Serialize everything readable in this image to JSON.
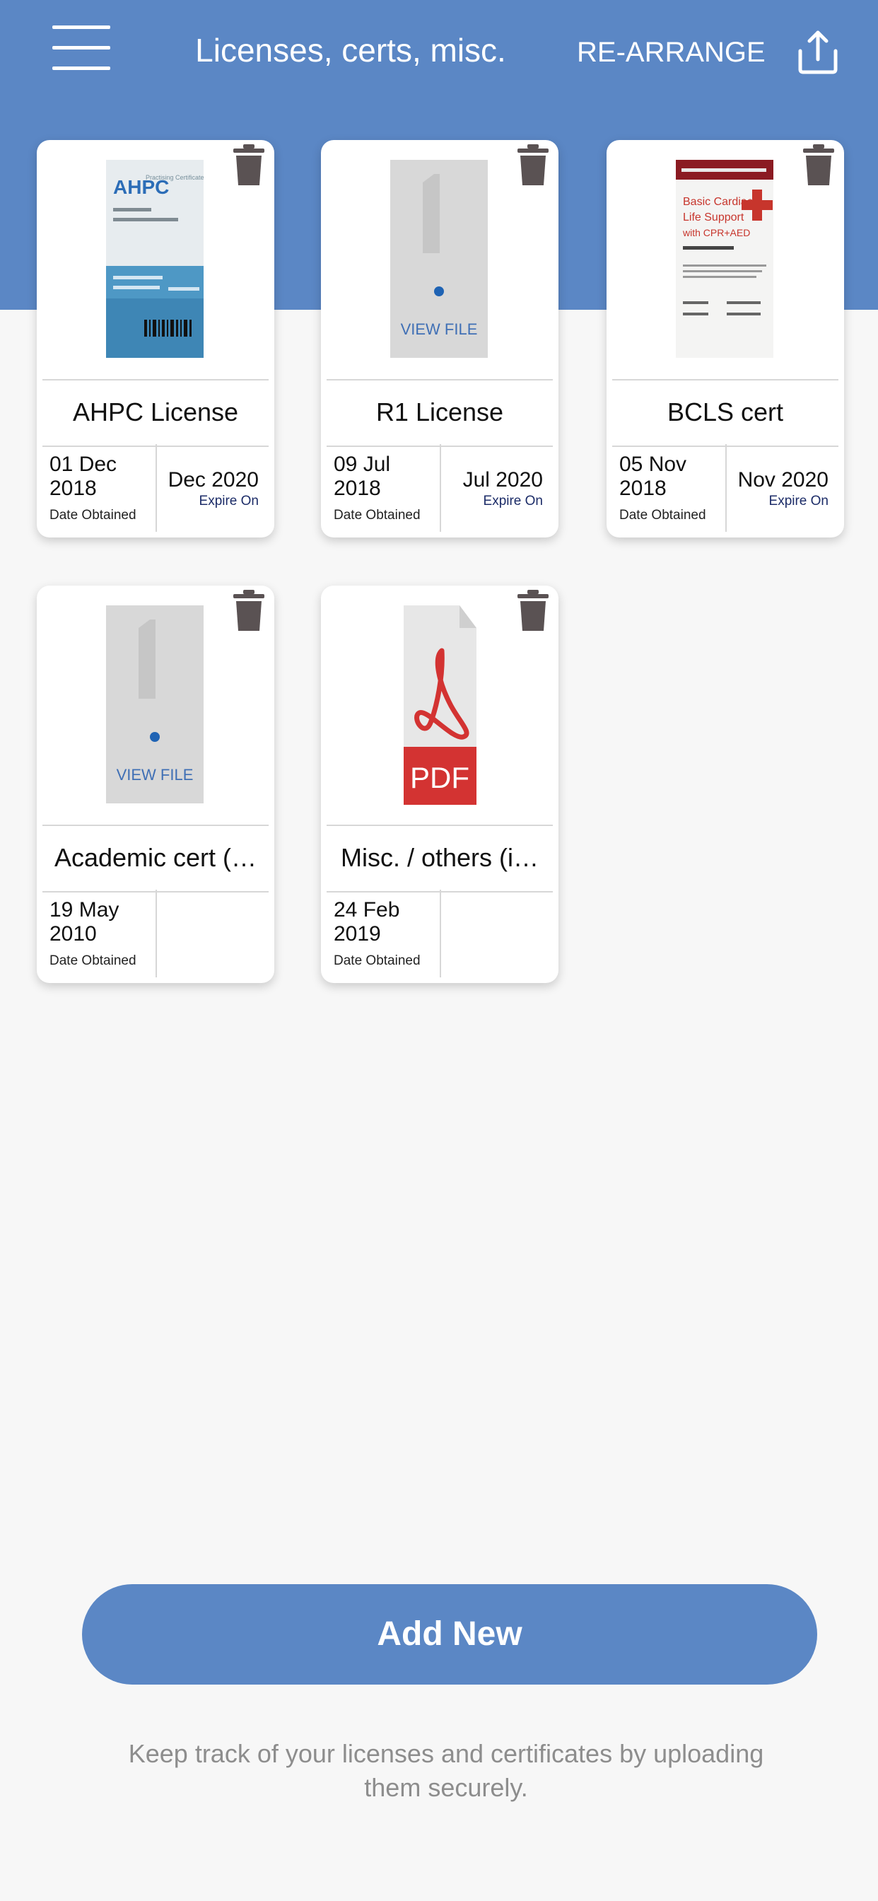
{
  "header": {
    "title": "Licenses, certs, misc.",
    "rearrange_label": "RE-ARRANGE",
    "menu_icon": "hamburger-menu-icon",
    "share_icon": "share-upload-icon",
    "color": "#5b87c5"
  },
  "cards": [
    {
      "title": "AHPC License",
      "date_obtained": "01 Dec 2018",
      "date_obtained_label": "Date Obtained",
      "expire_value": "Dec 2020",
      "expire_label": "Expire On",
      "thumb": "license-card-image",
      "thumb_texts": {
        "brand": "AHPC",
        "certificate_label": "Practising Certificate"
      }
    },
    {
      "title": "R1 License",
      "date_obtained": "09 Jul 2018",
      "date_obtained_label": "Date Obtained",
      "expire_value": "Jul 2020",
      "expire_label": "Expire On",
      "thumb": "view-file-placeholder",
      "thumb_text": "VIEW FILE"
    },
    {
      "title": "BCLS cert",
      "date_obtained": "05 Nov 2018",
      "date_obtained_label": "Date Obtained",
      "expire_value": "Nov 2020",
      "expire_label": "Expire On",
      "thumb": "bcls-certificate-image",
      "thumb_texts": {
        "line1": "Basic Cardiac",
        "line2": "Life Support",
        "line3": "with CPR+AED"
      }
    },
    {
      "title": "Academic cert (…",
      "date_obtained": "19 May 2010",
      "date_obtained_label": "Date Obtained",
      "expire_value": "",
      "expire_label": "",
      "thumb": "view-file-placeholder",
      "thumb_text": "VIEW FILE"
    },
    {
      "title": "Misc. / others (i…",
      "date_obtained": "24 Feb 2019",
      "date_obtained_label": "Date Obtained",
      "expire_value": "",
      "expire_label": "",
      "thumb": "pdf-file-icon",
      "thumb_text": "PDF"
    }
  ],
  "add_button_label": "Add New",
  "footer_text": "Keep track of your licenses and certificates by uploading them securely."
}
